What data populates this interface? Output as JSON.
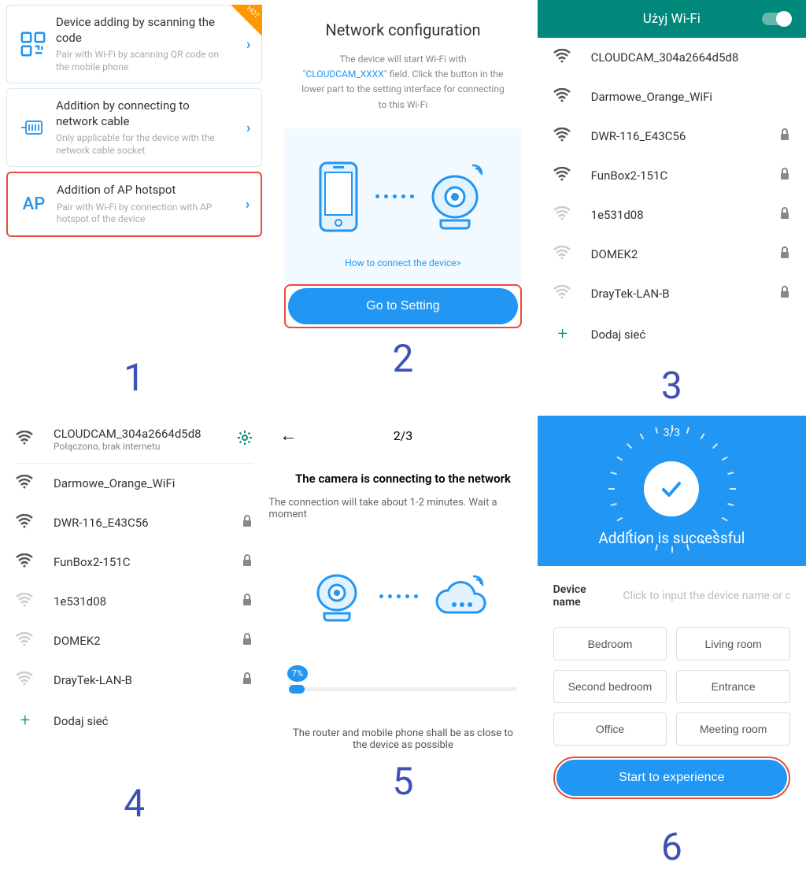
{
  "panel1": {
    "options": [
      {
        "title": "Device adding by scanning the code",
        "sub": "Pair with Wi-Fi by scanning QR code on the mobile phone",
        "hot": "HOT"
      },
      {
        "title": "Addition by connecting to network cable",
        "sub": "Only applicable for the device with the network cable socket"
      },
      {
        "title": "Addition of AP hotspot",
        "sub": "Pair with Wi-Fi by connection with AP hotspot of the device",
        "ap": "AP"
      }
    ]
  },
  "panel2": {
    "title": "Network configuration",
    "desc_pre": "The device will start Wi-Fi with \"",
    "desc_link": "CLOUDCAM_XXXX",
    "desc_post": "\" field. Click the button in the lower part to the setting interface for connecting to this Wi-Fi",
    "howto": "How to connect the device>",
    "button": "Go to Setting"
  },
  "panel3": {
    "header": "Użyj Wi-Fi",
    "networks": [
      {
        "name": "CLOUDCAM_304a2664d5d8",
        "strong": true,
        "lock": false
      },
      {
        "name": "Darmowe_Orange_WiFi",
        "strong": true,
        "lock": false
      },
      {
        "name": "DWR-116_E43C56",
        "strong": true,
        "lock": true
      },
      {
        "name": "FunBox2-151C",
        "strong": true,
        "lock": true
      },
      {
        "name": "1e531d08",
        "strong": false,
        "lock": true
      },
      {
        "name": "DOMEK2",
        "strong": false,
        "lock": true
      },
      {
        "name": "DrayTek-LAN-B",
        "strong": false,
        "lock": true
      }
    ],
    "add": "Dodaj sieć"
  },
  "panel4": {
    "networks": [
      {
        "name": "CLOUDCAM_304a2664d5d8",
        "sub": "Połączono, brak internetu",
        "strong": true,
        "gear": true
      },
      {
        "name": "Darmowe_Orange_WiFi",
        "strong": true
      },
      {
        "name": "DWR-116_E43C56",
        "strong": true,
        "lock": true
      },
      {
        "name": "FunBox2-151C",
        "strong": true,
        "lock": true
      },
      {
        "name": "1e531d08",
        "strong": false,
        "lock": true
      },
      {
        "name": "DOMEK2",
        "strong": false,
        "lock": true
      },
      {
        "name": "DrayTek-LAN-B",
        "strong": false,
        "lock": true
      }
    ],
    "add": "Dodaj sieć"
  },
  "panel5": {
    "step": "2/3",
    "title": "The camera is connecting to the network",
    "sub": "The connection will take about 1-2 minutes. Wait a moment",
    "progress": "7%",
    "hint": "The router and mobile phone shall be as close to the device as possible"
  },
  "panel6": {
    "step": "3/3",
    "success": "Addition is successful",
    "dname_label": "Device name",
    "dname_placeholder": "Click to input the device name or cho",
    "chips": [
      "Bedroom",
      "Living room",
      "Second bedroom",
      "Entrance",
      "Office",
      "Meeting room"
    ],
    "button": "Start to experience"
  },
  "labels": [
    "1",
    "2",
    "3",
    "4",
    "5",
    "6"
  ]
}
